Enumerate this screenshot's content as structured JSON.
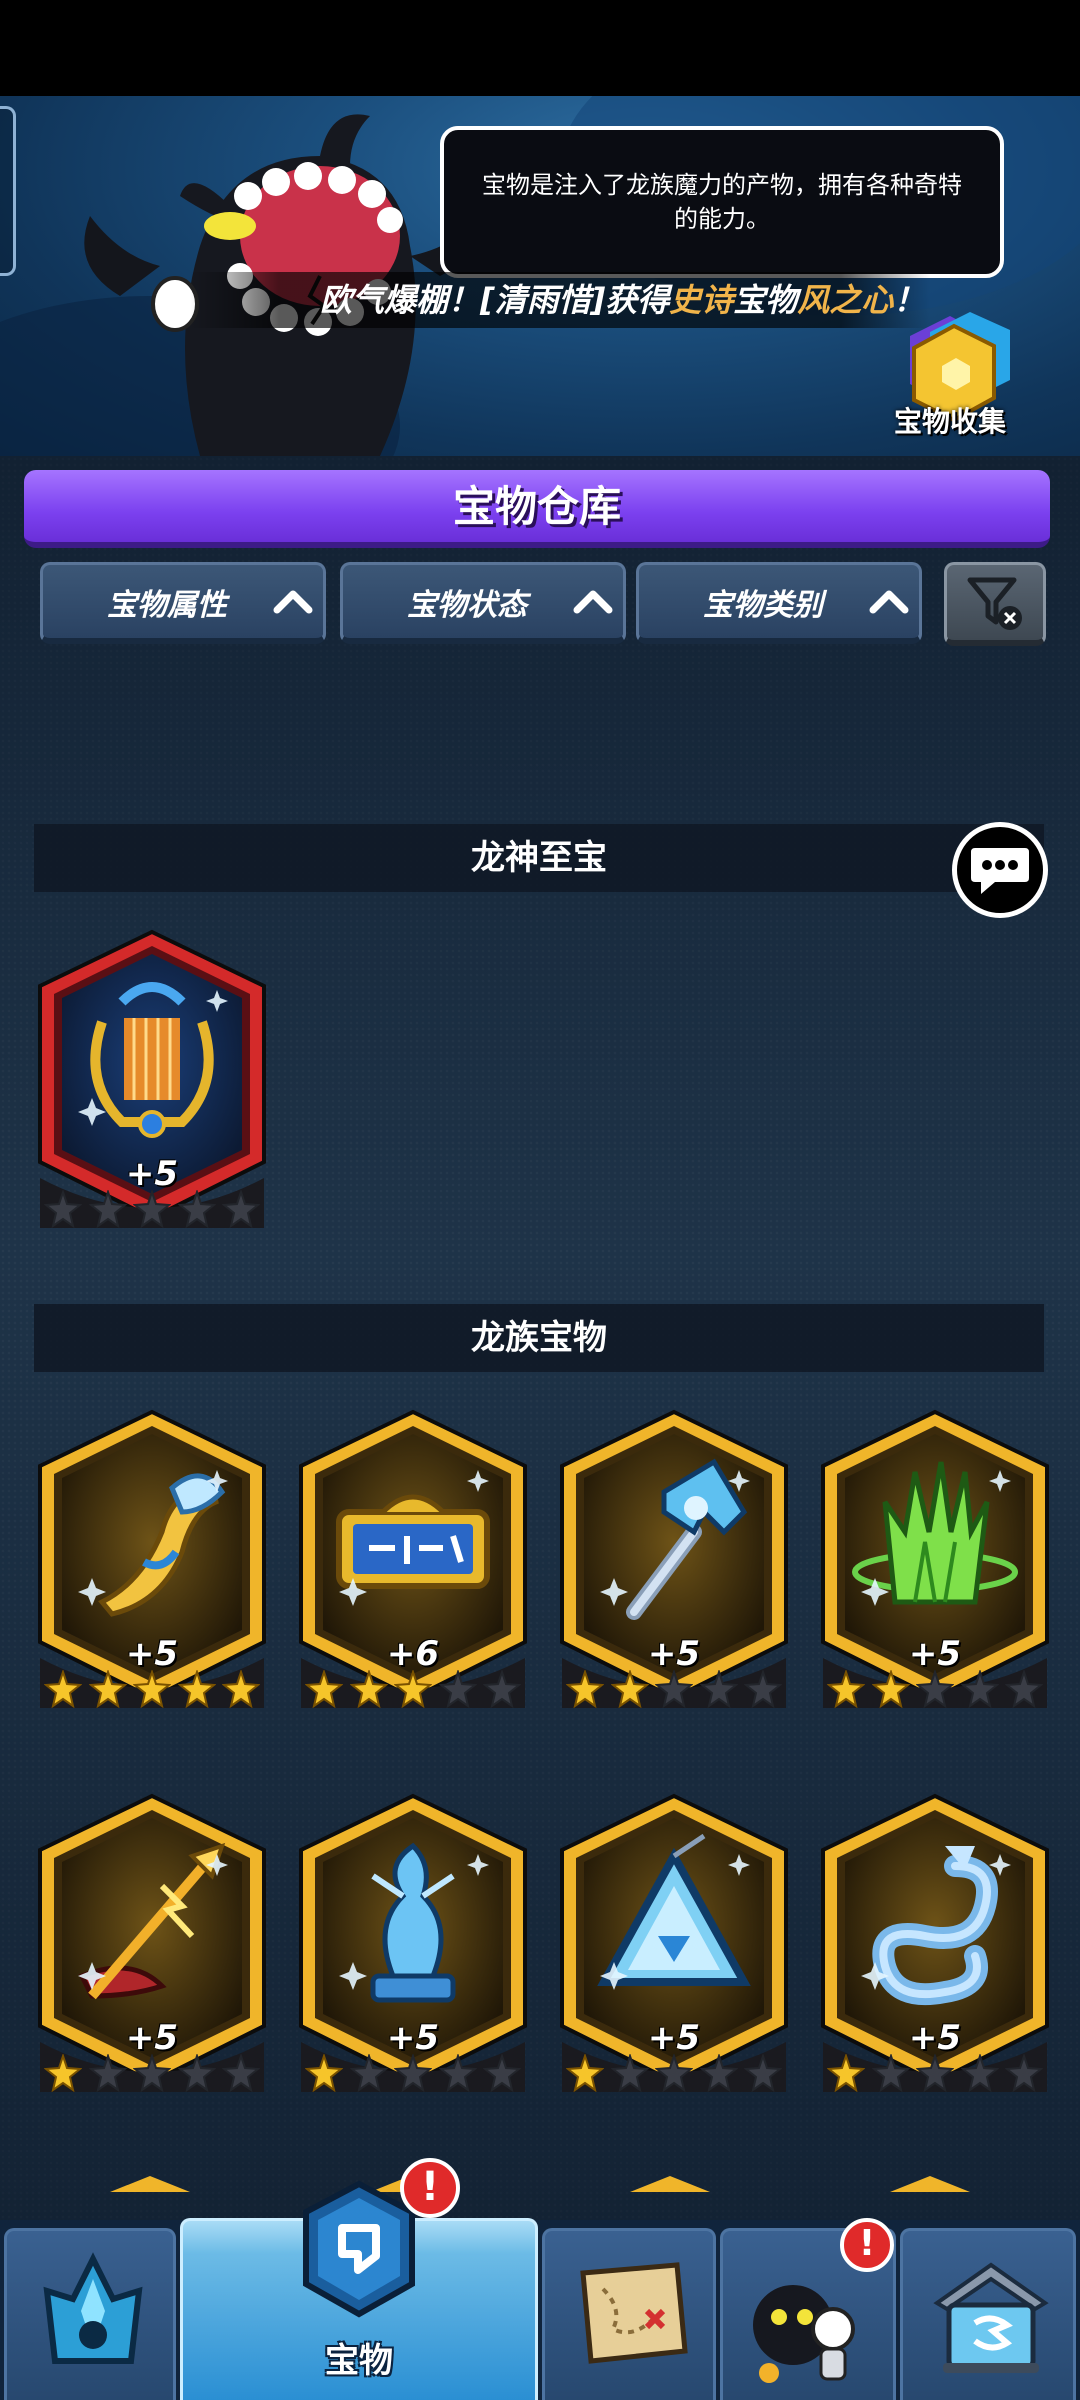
{
  "banner": {
    "description": "宝物是注入了龙族魔力的产物，拥有各种奇特的能力。",
    "broadcast": {
      "parts": [
        "欧气爆棚！[清雨惜]获得",
        "史诗",
        "宝物",
        "风之心",
        "！"
      ]
    },
    "collection_label": "宝物收集"
  },
  "panel": {
    "title": "宝物仓库",
    "filters": [
      "宝物属性",
      "宝物状态",
      "宝物类别"
    ]
  },
  "sections": [
    {
      "title": "龙神至宝",
      "items": [
        {
          "icon": "golden-lyre-icon",
          "level": "+5",
          "frame": "red",
          "stars_filled": 0
        }
      ]
    },
    {
      "title": "龙族宝物",
      "items": [
        {
          "icon": "ice-horn-icon",
          "level": "+5",
          "frame": "gold",
          "stars_filled": 5
        },
        {
          "icon": "signboard-icon",
          "level": "+6",
          "frame": "gold",
          "stars_filled": 3
        },
        {
          "icon": "ice-axe-icon",
          "level": "+5",
          "frame": "gold",
          "stars_filled": 2
        },
        {
          "icon": "green-crystal-claw-icon",
          "level": "+5",
          "frame": "gold",
          "stars_filled": 2
        },
        {
          "icon": "lightning-spear-icon",
          "level": "+5",
          "frame": "gold",
          "stars_filled": 1
        },
        {
          "icon": "ice-dragon-statue-icon",
          "level": "+5",
          "frame": "gold",
          "stars_filled": 1
        },
        {
          "icon": "ice-triangle-pendant-icon",
          "level": "+5",
          "frame": "gold",
          "stars_filled": 1
        },
        {
          "icon": "ice-serpent-dragon-icon",
          "level": "+5",
          "frame": "gold",
          "stars_filled": 1
        }
      ]
    }
  ],
  "nav": {
    "tabs": [
      {
        "icon": "crystal-tower-icon",
        "label": "",
        "active": false,
        "alert": false
      },
      {
        "icon": "treasure-rune-icon",
        "label": "宝物",
        "active": true,
        "alert": true
      },
      {
        "icon": "treasure-map-icon",
        "label": "",
        "active": false,
        "alert": false
      },
      {
        "icon": "demon-character-icon",
        "label": "",
        "active": false,
        "alert": true
      },
      {
        "icon": "shop-house-icon",
        "label": "",
        "active": false,
        "alert": false
      }
    ]
  },
  "colors": {
    "title_purple": "#8a50f5",
    "gold_frame": "#f0b52a",
    "red_frame": "#d42a2a",
    "highlight_text": "#f1b44a",
    "alert_red": "#e02a2a"
  }
}
